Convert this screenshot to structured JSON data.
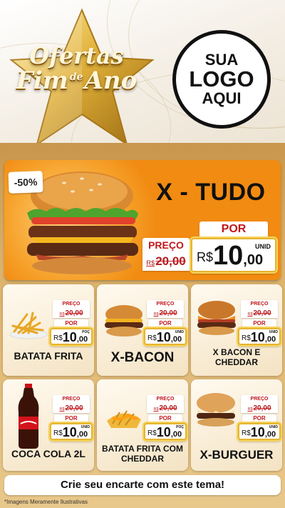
{
  "header": {
    "promo_line1": "Ofertas",
    "promo_line2a": "Fim",
    "promo_de": "de",
    "promo_line2b": "Ano",
    "logo_line1": "SUA",
    "logo_line2": "LOGO",
    "logo_line3": "AQUI"
  },
  "hero": {
    "name": "X - TUDO",
    "discount": "-50%",
    "preco_label": "PREÇO",
    "old_currency": "R$",
    "old_price": "20,00",
    "por_label": "POR",
    "new_currency": "R$",
    "new_price_int": "10",
    "new_price_dec": ",00",
    "unit": "UNID"
  },
  "products": [
    {
      "name": "BATATA FRITA",
      "preco_label": "PREÇO",
      "old_currency": "R$",
      "old_price": "20,00",
      "por_label": "POR",
      "new_currency": "R$",
      "new_price_int": "10",
      "new_price_dec": ",00",
      "unit": "POÇ"
    },
    {
      "name": "X-BACON",
      "preco_label": "PREÇO",
      "old_currency": "R$",
      "old_price": "20,00",
      "por_label": "POR",
      "new_currency": "R$",
      "new_price_int": "10",
      "new_price_dec": ",00",
      "unit": "UNID"
    },
    {
      "name": "X BACON E CHEDDAR",
      "preco_label": "PREÇO",
      "old_currency": "R$",
      "old_price": "20,00",
      "por_label": "POR",
      "new_currency": "R$",
      "new_price_int": "10",
      "new_price_dec": ",00",
      "unit": "UNID"
    },
    {
      "name": "COCA COLA 2L",
      "preco_label": "PREÇO",
      "old_currency": "R$",
      "old_price": "20,00",
      "por_label": "POR",
      "new_currency": "R$",
      "new_price_int": "10",
      "new_price_dec": ",00",
      "unit": "UNID"
    },
    {
      "name": "BATATA FRITA COM CHEDDAR",
      "preco_label": "PREÇO",
      "old_currency": "R$",
      "old_price": "20,00",
      "por_label": "POR",
      "new_currency": "R$",
      "new_price_int": "10",
      "new_price_dec": ",00",
      "unit": "POÇ"
    },
    {
      "name": "X-BURGUER",
      "preco_label": "PREÇO",
      "old_currency": "R$",
      "old_price": "20,00",
      "por_label": "POR",
      "new_currency": "R$",
      "new_price_int": "10",
      "new_price_dec": ",00",
      "unit": "UNID"
    }
  ],
  "footer": {
    "cta": "Crie seu encarte com este tema!",
    "disclaimer": "*Imagens Meramente Ilustrativas"
  },
  "colors": {
    "hero_bg": "#f18b12",
    "band_gold": "#ddb26b",
    "price_red": "#c0171b",
    "tag_gold_border": "#e5b431"
  },
  "icons": [
    "gold-star-icon",
    "burger-image",
    "fries-image",
    "cola-bottle-image",
    "heart-icon"
  ]
}
